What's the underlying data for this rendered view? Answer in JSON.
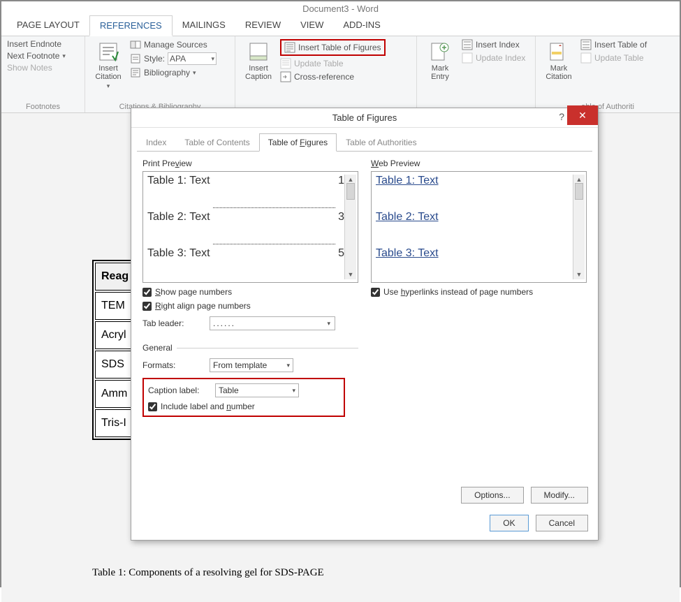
{
  "window_title": "Document3 - Word",
  "ribbon_tabs": [
    "PAGE LAYOUT",
    "REFERENCES",
    "MAILINGS",
    "REVIEW",
    "VIEW",
    "ADD-INS"
  ],
  "ribbon_active_tab": "REFERENCES",
  "ribbon": {
    "footnotes": {
      "insert_endnote": "Insert Endnote",
      "next_footnote": "Next Footnote",
      "show_notes": "Show Notes",
      "group_label": "Footnotes"
    },
    "citations": {
      "insert_citation": "Insert\nCitation",
      "manage_sources": "Manage Sources",
      "style_label": "Style:",
      "style_value": "APA",
      "bibliography": "Bibliography",
      "group_label": "Citations & Bibliography"
    },
    "captions": {
      "insert_caption": "Insert\nCaption",
      "insert_tof": "Insert Table of Figures",
      "update_table": "Update Table",
      "cross_reference": "Cross-reference"
    },
    "index": {
      "mark_entry": "Mark\nEntry",
      "insert_index": "Insert Index",
      "update_index": "Update Index"
    },
    "authorities": {
      "mark_citation": "Mark\nCitation",
      "insert_toa": "Insert Table of",
      "update_toa": "Update Table",
      "group_label": "able of Authoriti"
    }
  },
  "dialog": {
    "title": "Table of Figures",
    "tabs": [
      "Index",
      "Table of Contents",
      "Table of Figures",
      "Table of Authorities"
    ],
    "active_tab": "Table of Figures",
    "print_label": "Print Preview",
    "web_label": "Web Preview",
    "print_entries": [
      {
        "text": "Table 1: Text",
        "page": "1"
      },
      {
        "text": "Table 2: Text",
        "page": "3"
      },
      {
        "text": "Table 3: Text",
        "page": "5"
      }
    ],
    "web_entries": [
      "Table 1: Text",
      "Table 2: Text",
      "Table 3: Text"
    ],
    "show_page_numbers": "Show page numbers",
    "right_align": "Right align page numbers",
    "use_hyperlinks": "Use hyperlinks instead of page numbers",
    "tab_leader_label": "Tab leader:",
    "tab_leader_value": "......",
    "general_label": "General",
    "formats_label": "Formats:",
    "formats_value": "From template",
    "caption_label_label": "Caption label:",
    "caption_label_value": "Table",
    "include_label": "Include label and number",
    "options": "Options...",
    "modify": "Modify...",
    "ok": "OK",
    "cancel": "Cancel"
  },
  "doc": {
    "rows": [
      "Reag",
      "TEM",
      "Acryl",
      "SDS",
      "Amm",
      "Tris-I"
    ],
    "caption": "Table 1: Components of a resolving gel for SDS-PAGE"
  }
}
